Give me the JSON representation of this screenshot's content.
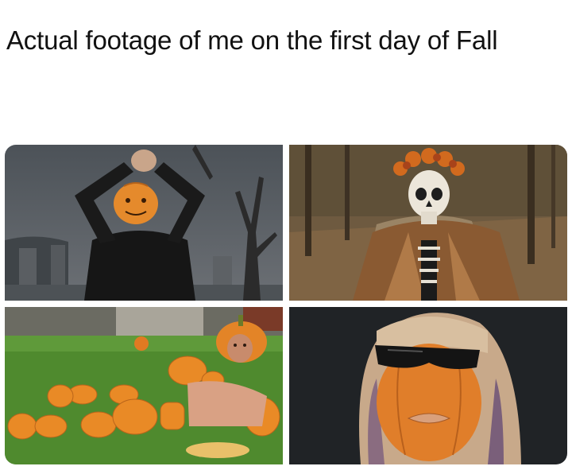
{
  "post": {
    "caption": "Actual footage of me on the first day of Fall"
  },
  "panels": [
    {
      "icon": "pumpkin-head-dancer-image"
    },
    {
      "icon": "skeleton-in-fur-coat-image"
    },
    {
      "icon": "pumpkin-body-man-image"
    },
    {
      "icon": "pumpkin-lady-gaga-image"
    }
  ]
}
